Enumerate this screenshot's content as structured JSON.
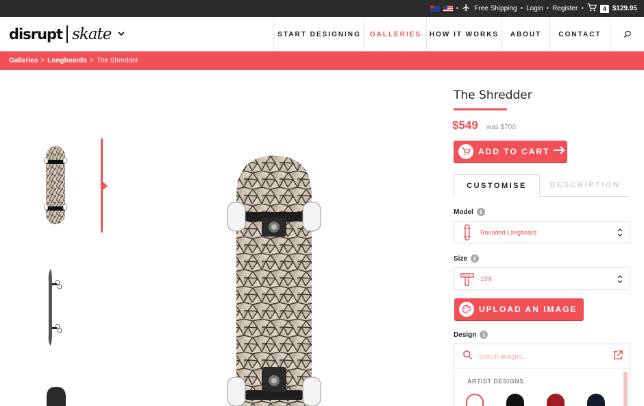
{
  "topbar": {
    "flags": [
      "australia-flag",
      "usa-flag"
    ],
    "shipping": "Free Shipping",
    "login": "Login",
    "register": "Register",
    "cart_count": "4",
    "cart_total": "$129.95"
  },
  "header": {
    "logo_left": "disrupt",
    "logo_right": "skate",
    "nav": [
      {
        "label": "START DESIGNING",
        "active": false
      },
      {
        "label": "GALLERIES",
        "active": true
      },
      {
        "label": "HOW IT WORKS",
        "active": false
      },
      {
        "label": "ABOUT",
        "active": false
      },
      {
        "label": "CONTACT",
        "active": false
      }
    ]
  },
  "breadcrumb": [
    "Galleries",
    "Longboards",
    "The Shredder"
  ],
  "breadcrumb_sep": ">",
  "product": {
    "title": "The Shredder",
    "price": "$549",
    "was_price": "was $700",
    "add_to_cart": "ADD TO CART",
    "tabs": [
      "CUSTOMISE",
      "DESCRIPTION"
    ],
    "model_label": "Model",
    "model_value": "Rounded Longboard",
    "size_label": "Size",
    "size_value": "10'9",
    "upload_label": "UPLOAD AN IMAGE",
    "design_label": "Design",
    "search_placeholder": "Search designs...",
    "artist_designs": "ARTIST DESIGNS"
  },
  "colors": {
    "accent": "#f05056",
    "topbar": "#2b2b2b",
    "wood": "#cfc3b4"
  }
}
